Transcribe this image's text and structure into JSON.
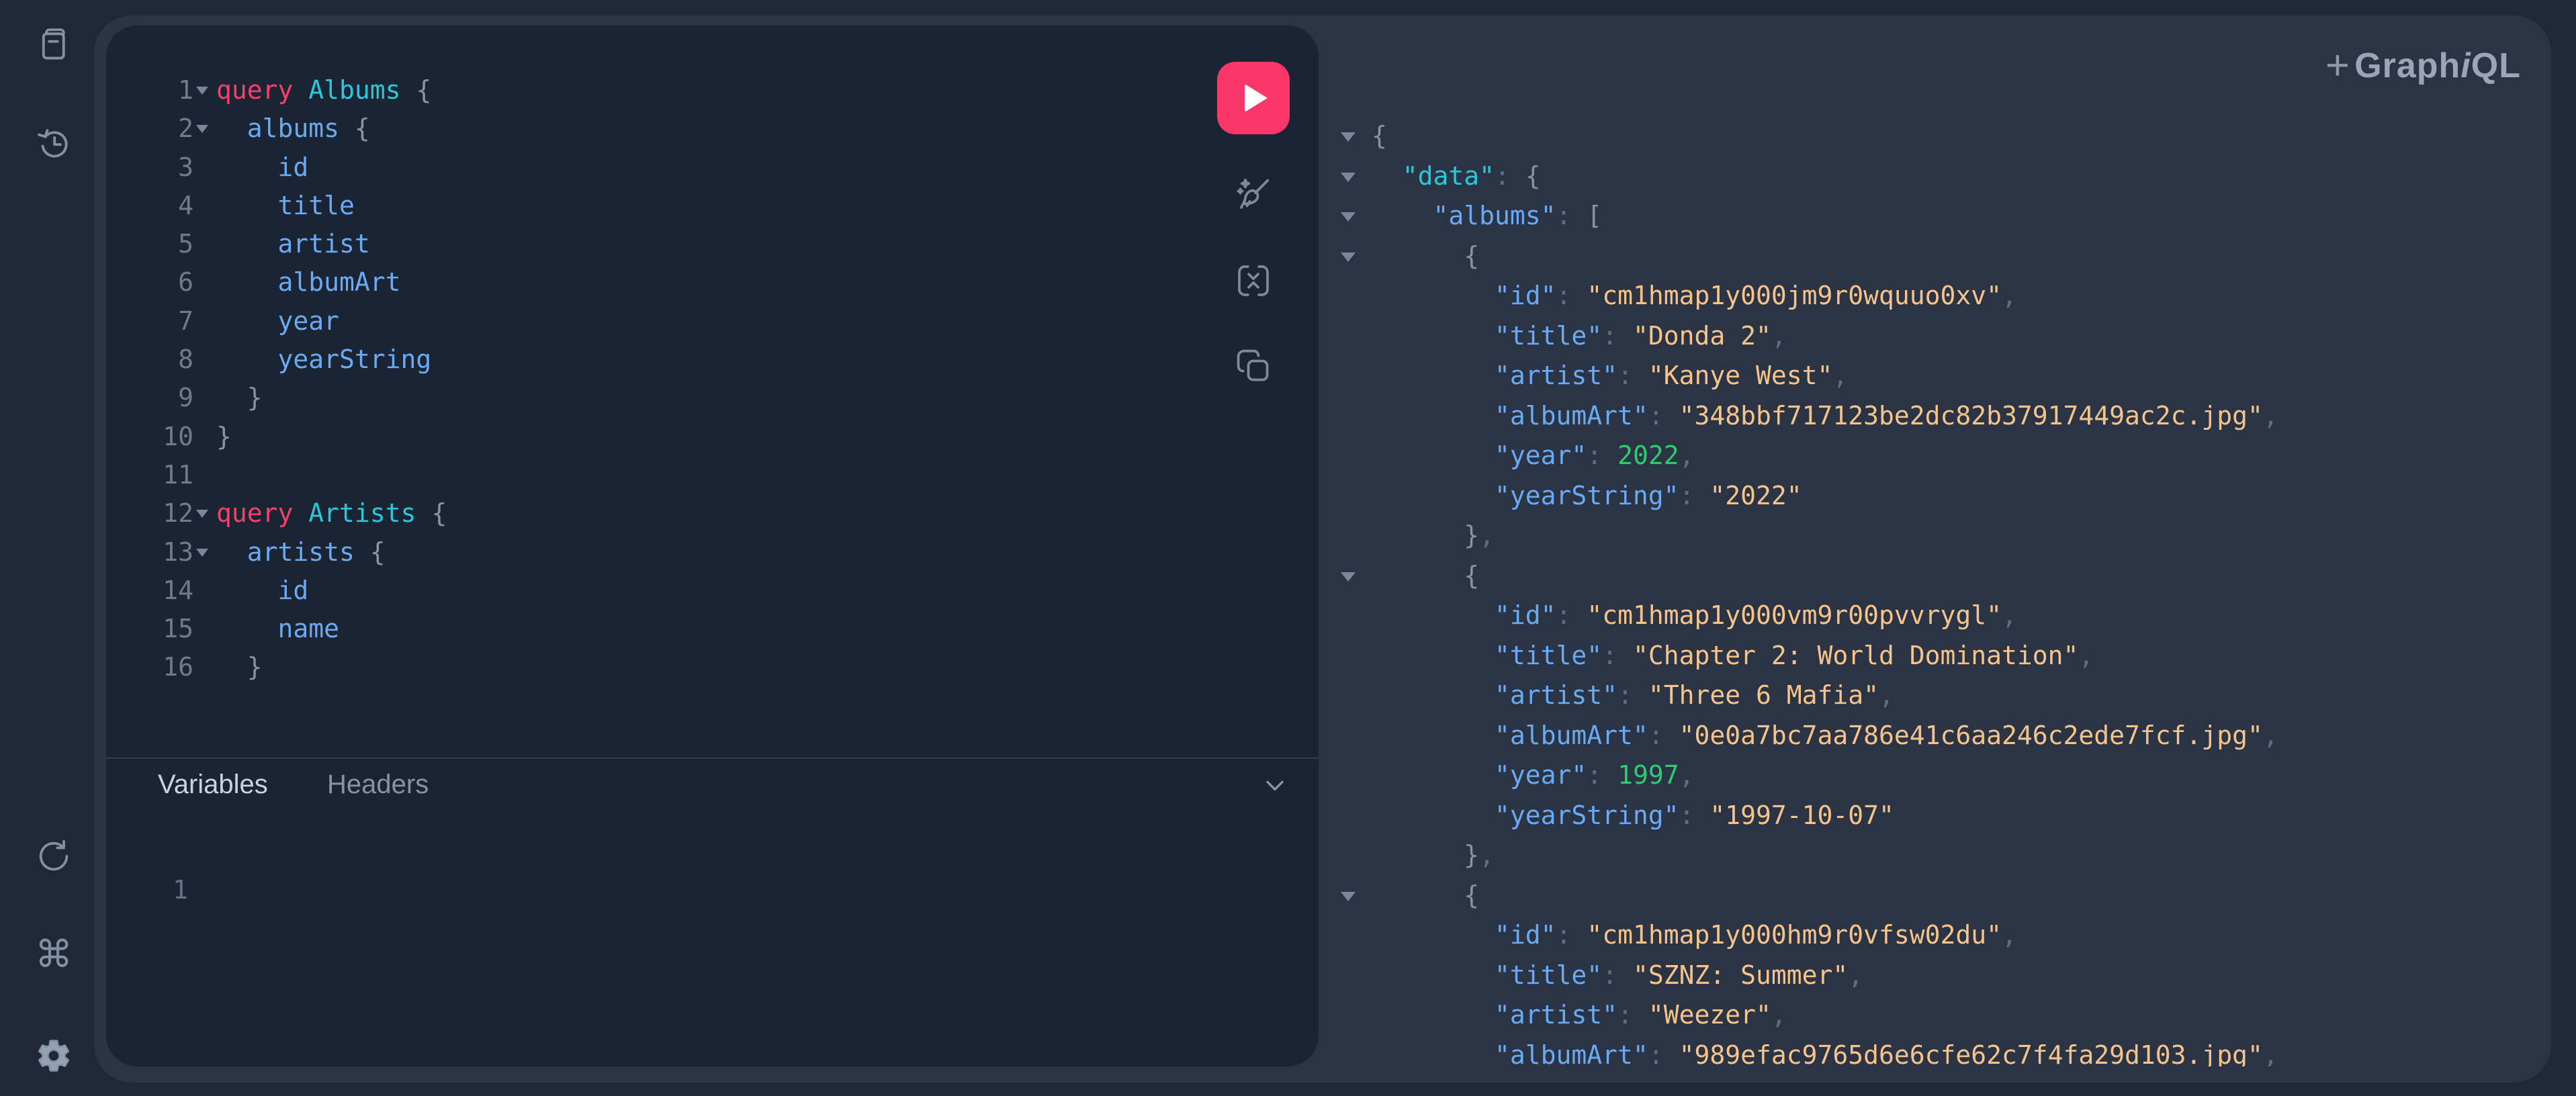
{
  "logo": {
    "add_tab": "+",
    "part1": "Graph",
    "part2": "i",
    "part3": "QL"
  },
  "colors": {
    "page_bg": "#202837",
    "container_bg": "#2b3444",
    "panel_bg": "#1b2433",
    "accent_pink": "#fa3768",
    "keyword_pink": "#fb3e69",
    "type_cyan": "#27c8da",
    "field_blue": "#6aa9f4",
    "string_orange": "#f6c48a",
    "number_green": "#2fca72"
  },
  "sidebar": {
    "icons": [
      "docs-icon",
      "history-icon",
      "refetch-icon",
      "shortcut-keys-icon",
      "settings-icon"
    ]
  },
  "toolbar": {
    "icons": [
      "execute-query",
      "prettify-query",
      "merge-fragments",
      "copy-query"
    ]
  },
  "editor": {
    "lines": [
      {
        "n": "1",
        "fold": true,
        "tokens": [
          [
            "kw",
            "query "
          ],
          [
            "ty",
            "Albums "
          ],
          [
            "b",
            "{"
          ]
        ]
      },
      {
        "n": "2",
        "fold": true,
        "tokens": [
          [
            "f",
            "  albums "
          ],
          [
            "b",
            "{"
          ]
        ]
      },
      {
        "n": "3",
        "fold": false,
        "tokens": [
          [
            "f",
            "    id"
          ]
        ]
      },
      {
        "n": "4",
        "fold": false,
        "tokens": [
          [
            "f",
            "    title"
          ]
        ]
      },
      {
        "n": "5",
        "fold": false,
        "tokens": [
          [
            "f",
            "    artist"
          ]
        ]
      },
      {
        "n": "6",
        "fold": false,
        "tokens": [
          [
            "f",
            "    albumArt"
          ]
        ]
      },
      {
        "n": "7",
        "fold": false,
        "tokens": [
          [
            "f",
            "    year"
          ]
        ]
      },
      {
        "n": "8",
        "fold": false,
        "tokens": [
          [
            "f",
            "    yearString"
          ]
        ]
      },
      {
        "n": "9",
        "fold": false,
        "tokens": [
          [
            "b",
            "  }"
          ]
        ]
      },
      {
        "n": "10",
        "fold": false,
        "tokens": [
          [
            "b",
            "}"
          ]
        ]
      },
      {
        "n": "11",
        "fold": false,
        "tokens": []
      },
      {
        "n": "12",
        "fold": true,
        "tokens": [
          [
            "kw",
            "query "
          ],
          [
            "ty",
            "Artists "
          ],
          [
            "b",
            "{"
          ]
        ]
      },
      {
        "n": "13",
        "fold": true,
        "tokens": [
          [
            "f",
            "  artists "
          ],
          [
            "b",
            "{"
          ]
        ]
      },
      {
        "n": "14",
        "fold": false,
        "tokens": [
          [
            "f",
            "    id"
          ]
        ]
      },
      {
        "n": "15",
        "fold": false,
        "tokens": [
          [
            "f",
            "    name"
          ]
        ]
      },
      {
        "n": "16",
        "fold": false,
        "tokens": [
          [
            "b",
            "  }"
          ]
        ]
      }
    ]
  },
  "secondary_editor": {
    "tabs": [
      {
        "label": "Variables",
        "active": true
      },
      {
        "label": "Headers",
        "active": false
      }
    ],
    "collapse_icon": "chevron-down-icon",
    "gutter_line": "1"
  },
  "response": {
    "lines": [
      {
        "fold": true,
        "tokens": [
          [
            "b",
            "{"
          ]
        ]
      },
      {
        "fold": true,
        "tokens": [
          [
            "ck",
            "  \"data\""
          ],
          [
            "p",
            ": "
          ],
          [
            "b",
            "{"
          ]
        ]
      },
      {
        "fold": true,
        "tokens": [
          [
            "k",
            "    \"albums\""
          ],
          [
            "p",
            ": "
          ],
          [
            "b",
            "["
          ]
        ]
      },
      {
        "fold": true,
        "tokens": [
          [
            "b",
            "      {"
          ]
        ]
      },
      {
        "fold": false,
        "tokens": [
          [
            "k",
            "        \"id\""
          ],
          [
            "p",
            ": "
          ],
          [
            "s",
            "\"cm1hmap1y000jm9r0wquuo0xv\""
          ],
          [
            "p",
            ","
          ]
        ]
      },
      {
        "fold": false,
        "tokens": [
          [
            "k",
            "        \"title\""
          ],
          [
            "p",
            ": "
          ],
          [
            "s",
            "\"Donda 2\""
          ],
          [
            "p",
            ","
          ]
        ]
      },
      {
        "fold": false,
        "tokens": [
          [
            "k",
            "        \"artist\""
          ],
          [
            "p",
            ": "
          ],
          [
            "s",
            "\"Kanye West\""
          ],
          [
            "p",
            ","
          ]
        ]
      },
      {
        "fold": false,
        "tokens": [
          [
            "k",
            "        \"albumArt\""
          ],
          [
            "p",
            ": "
          ],
          [
            "s",
            "\"348bbf717123be2dc82b37917449ac2c.jpg\""
          ],
          [
            "p",
            ","
          ]
        ]
      },
      {
        "fold": false,
        "tokens": [
          [
            "k",
            "        \"year\""
          ],
          [
            "p",
            ": "
          ],
          [
            "n",
            "2022"
          ],
          [
            "p",
            ","
          ]
        ]
      },
      {
        "fold": false,
        "tokens": [
          [
            "k",
            "        \"yearString\""
          ],
          [
            "p",
            ": "
          ],
          [
            "s",
            "\"2022\""
          ]
        ]
      },
      {
        "fold": false,
        "tokens": [
          [
            "b",
            "      }"
          ],
          [
            "p",
            ","
          ]
        ]
      },
      {
        "fold": true,
        "tokens": [
          [
            "b",
            "      {"
          ]
        ]
      },
      {
        "fold": false,
        "tokens": [
          [
            "k",
            "        \"id\""
          ],
          [
            "p",
            ": "
          ],
          [
            "s",
            "\"cm1hmap1y000vm9r00pvvrygl\""
          ],
          [
            "p",
            ","
          ]
        ]
      },
      {
        "fold": false,
        "tokens": [
          [
            "k",
            "        \"title\""
          ],
          [
            "p",
            ": "
          ],
          [
            "s",
            "\"Chapter 2: World Domination\""
          ],
          [
            "p",
            ","
          ]
        ]
      },
      {
        "fold": false,
        "tokens": [
          [
            "k",
            "        \"artist\""
          ],
          [
            "p",
            ": "
          ],
          [
            "s",
            "\"Three 6 Mafia\""
          ],
          [
            "p",
            ","
          ]
        ]
      },
      {
        "fold": false,
        "tokens": [
          [
            "k",
            "        \"albumArt\""
          ],
          [
            "p",
            ": "
          ],
          [
            "s",
            "\"0e0a7bc7aa786e41c6aa246c2ede7fcf.jpg\""
          ],
          [
            "p",
            ","
          ]
        ]
      },
      {
        "fold": false,
        "tokens": [
          [
            "k",
            "        \"year\""
          ],
          [
            "p",
            ": "
          ],
          [
            "n",
            "1997"
          ],
          [
            "p",
            ","
          ]
        ]
      },
      {
        "fold": false,
        "tokens": [
          [
            "k",
            "        \"yearString\""
          ],
          [
            "p",
            ": "
          ],
          [
            "s",
            "\"1997-10-07\""
          ]
        ]
      },
      {
        "fold": false,
        "tokens": [
          [
            "b",
            "      }"
          ],
          [
            "p",
            ","
          ]
        ]
      },
      {
        "fold": true,
        "tokens": [
          [
            "b",
            "      {"
          ]
        ]
      },
      {
        "fold": false,
        "tokens": [
          [
            "k",
            "        \"id\""
          ],
          [
            "p",
            ": "
          ],
          [
            "s",
            "\"cm1hmap1y000hm9r0vfsw02du\""
          ],
          [
            "p",
            ","
          ]
        ]
      },
      {
        "fold": false,
        "tokens": [
          [
            "k",
            "        \"title\""
          ],
          [
            "p",
            ": "
          ],
          [
            "s",
            "\"SZNZ: Summer\""
          ],
          [
            "p",
            ","
          ]
        ]
      },
      {
        "fold": false,
        "tokens": [
          [
            "k",
            "        \"artist\""
          ],
          [
            "p",
            ": "
          ],
          [
            "s",
            "\"Weezer\""
          ],
          [
            "p",
            ","
          ]
        ]
      },
      {
        "fold": false,
        "tokens": [
          [
            "k",
            "        \"albumArt\""
          ],
          [
            "p",
            ": "
          ],
          [
            "s",
            "\"989efac9765d6e6cfe62c7f4fa29d103.jpg\""
          ],
          [
            "p",
            ","
          ]
        ]
      }
    ]
  }
}
